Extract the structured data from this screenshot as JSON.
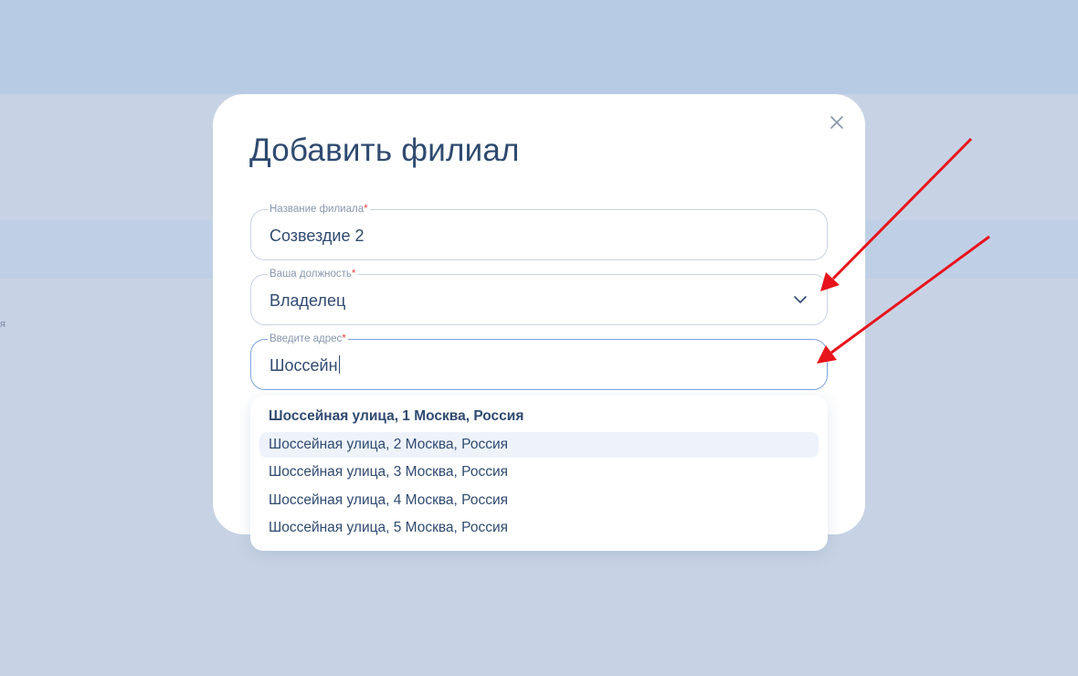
{
  "modal": {
    "title": "Добавить филиал",
    "close_icon": "close-icon"
  },
  "fields": {
    "branch_name": {
      "label": "Название филиала",
      "required_mark": "*",
      "value": "Созвездие 2"
    },
    "position": {
      "label": "Ваша должность",
      "required_mark": "*",
      "value": "Владелец",
      "icon": "chevron-down-icon"
    },
    "address": {
      "label": "Введите адрес",
      "required_mark": "*",
      "value": "Шоссейн"
    }
  },
  "suggestions": [
    "Шоссейная улица, 1 Москва, Россия",
    "Шоссейная улица, 2 Москва, Россия",
    "Шоссейная улица, 3 Москва, Россия",
    "Шоссейная улица, 4 Москва, Россия",
    "Шоссейная улица, 5 Москва, Россия"
  ],
  "background": {
    "edge_text": "я"
  },
  "colors": {
    "accent": "#7ea3de",
    "text": "#2f4a70",
    "required": "#e0444a",
    "annotation_arrow": "#e8141c"
  }
}
